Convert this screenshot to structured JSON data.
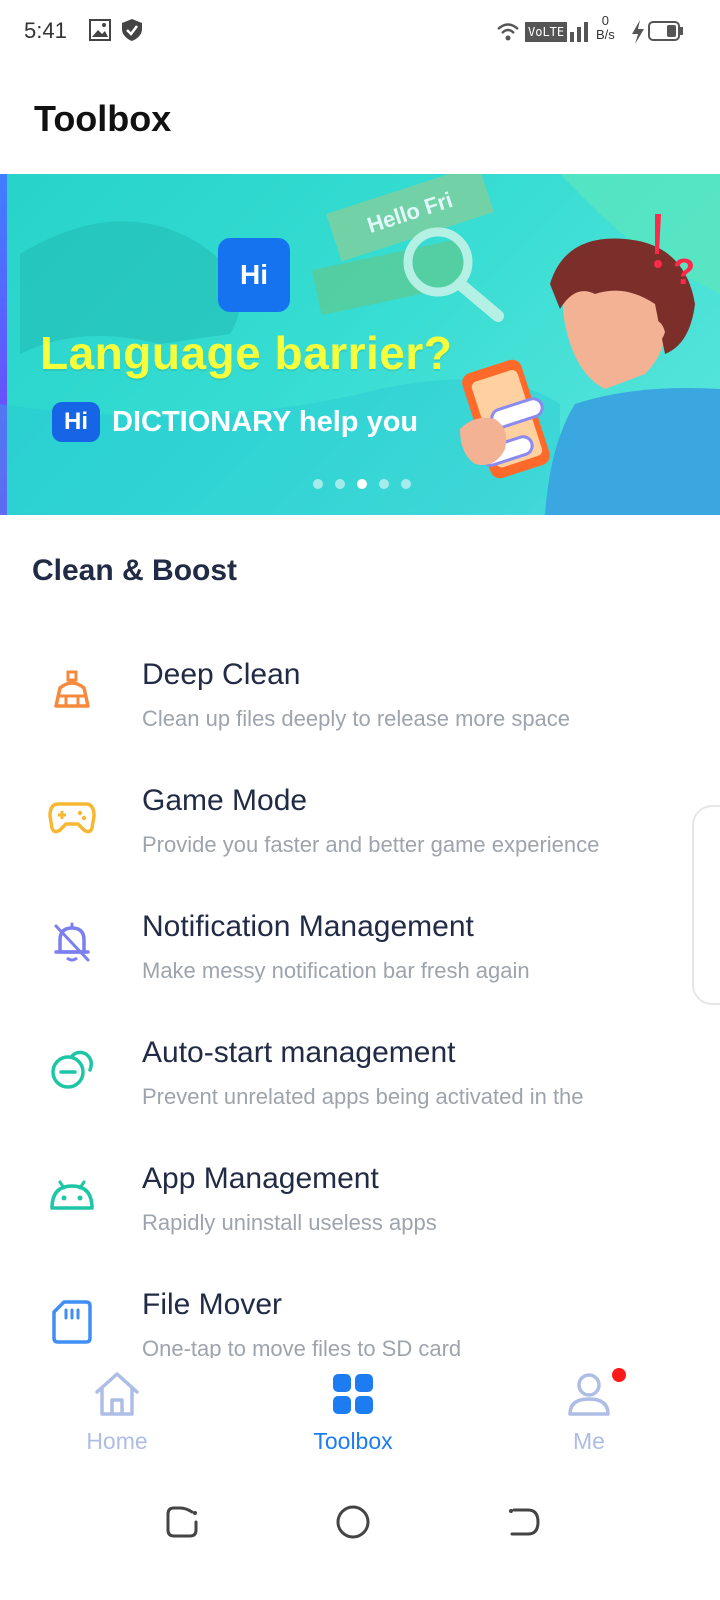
{
  "status_bar": {
    "time": "5:41",
    "volte": "VoLTE",
    "net_speed_value": "0",
    "net_speed_unit": "B/s",
    "icons": [
      "image-icon",
      "shield-icon",
      "wifi-icon",
      "volte-icon",
      "signal-icon",
      "charging-icon",
      "battery-icon"
    ]
  },
  "header": {
    "title": "Toolbox"
  },
  "banner": {
    "headline": "Language barrier?",
    "badge": "Hi",
    "subtitle": "DICTIONARY help you",
    "hello_text": "Hello Fri",
    "slide_count": 5,
    "active_slide": 3,
    "colors": {
      "background": "#2fd8cd",
      "headline": "#f6ff3c",
      "badge": "#1565e6"
    }
  },
  "section": {
    "title": "Clean & Boost"
  },
  "tools": [
    {
      "name": "Deep Clean",
      "desc": "Clean up files deeply to release more space",
      "icon": "broom-icon",
      "color": "#f58a3c"
    },
    {
      "name": "Game Mode",
      "desc": "Provide you faster and better game experience",
      "icon": "gamepad-icon",
      "color": "#f7b733"
    },
    {
      "name": "Notification Management",
      "desc": "Make messy notification bar fresh again",
      "icon": "bell-off-icon",
      "color": "#7b7ff0"
    },
    {
      "name": "Auto-start management",
      "desc": "Prevent unrelated apps being activated in the",
      "icon": "auto-start-icon",
      "color": "#1fc6a6"
    },
    {
      "name": "App Management",
      "desc": "Rapidly uninstall useless apps",
      "icon": "android-icon",
      "color": "#1fc6a6"
    },
    {
      "name": "File Mover",
      "desc": "One-tap to move files to SD card",
      "icon": "sd-card-icon",
      "color": "#3f8ef5"
    }
  ],
  "bottom_nav": {
    "items": [
      {
        "label": "Home",
        "icon": "home-icon",
        "active": false
      },
      {
        "label": "Toolbox",
        "icon": "grid-icon",
        "active": true
      },
      {
        "label": "Me",
        "icon": "person-icon",
        "active": false
      }
    ],
    "active_color": "#1d7cf2",
    "inactive_color": "#aebde6",
    "me_has_notification": true
  },
  "system_nav": {
    "buttons": [
      "recents-button",
      "home-button",
      "back-button"
    ]
  }
}
